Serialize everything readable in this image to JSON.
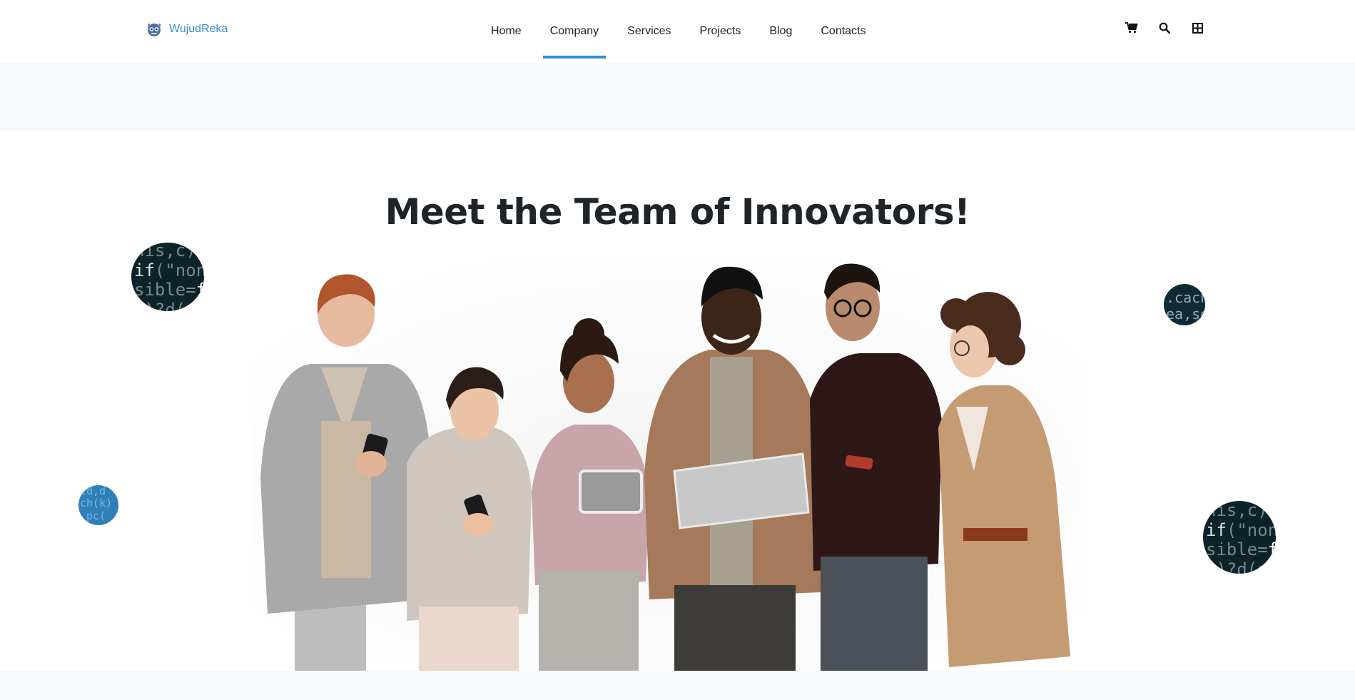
{
  "brand": {
    "name": "WujudReka"
  },
  "nav": {
    "items": [
      {
        "label": "Home"
      },
      {
        "label": "Company",
        "active": true
      },
      {
        "label": "Services"
      },
      {
        "label": "Projects"
      },
      {
        "label": "Blog"
      },
      {
        "label": "Contacts"
      }
    ]
  },
  "tools": {
    "icons": [
      "cart-icon",
      "search-icon",
      "grid-icon"
    ]
  },
  "hero": {
    "title": "Meet the Team of Innovators!"
  },
  "colors": {
    "accent": "#2f8fd6",
    "heading": "#1f2429",
    "band": "#f8f9fa"
  }
}
